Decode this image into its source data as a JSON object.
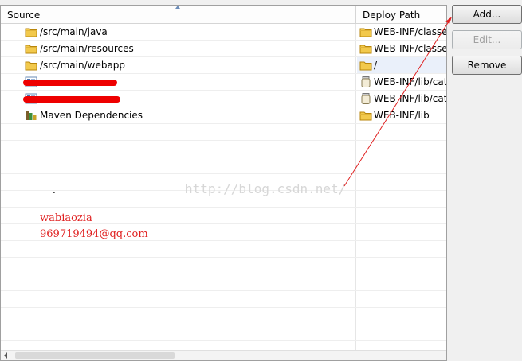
{
  "table": {
    "headers": {
      "source": "Source",
      "deploy_path": "Deploy Path"
    },
    "rows": [
      {
        "source": "/src/main/java",
        "source_icon": "folder-icon",
        "deploy": "WEB-INF/classes",
        "deploy_icon": "folder-icon"
      },
      {
        "source": "/src/main/resources",
        "source_icon": "folder-icon",
        "deploy": "WEB-INF/classes",
        "deploy_icon": "folder-icon"
      },
      {
        "source": "/src/main/webapp",
        "source_icon": "folder-icon",
        "deploy": "/",
        "deploy_icon": "folder-icon",
        "selected": true
      },
      {
        "source": "",
        "source_icon": "project-icon",
        "deploy": "WEB-INF/lib/cat",
        "deploy_icon": "jar-icon",
        "redacted": true
      },
      {
        "source": "",
        "source_icon": "project-icon",
        "deploy": "WEB-INF/lib/cat",
        "deploy_icon": "jar-icon",
        "redacted": true
      },
      {
        "source": "Maven Dependencies",
        "source_icon": "library-icon",
        "deploy": "WEB-INF/lib",
        "deploy_icon": "folder-icon"
      }
    ]
  },
  "buttons": {
    "add": "Add...",
    "edit": "Edit...",
    "remove": "Remove"
  },
  "annotations": {
    "watermark": "http://blog.csdn.net/",
    "dot": ".",
    "author": "wabiaozia",
    "email": "969719494@qq.com"
  },
  "colors": {
    "annotation": "#e02020",
    "selection": "#eaf0fa"
  }
}
